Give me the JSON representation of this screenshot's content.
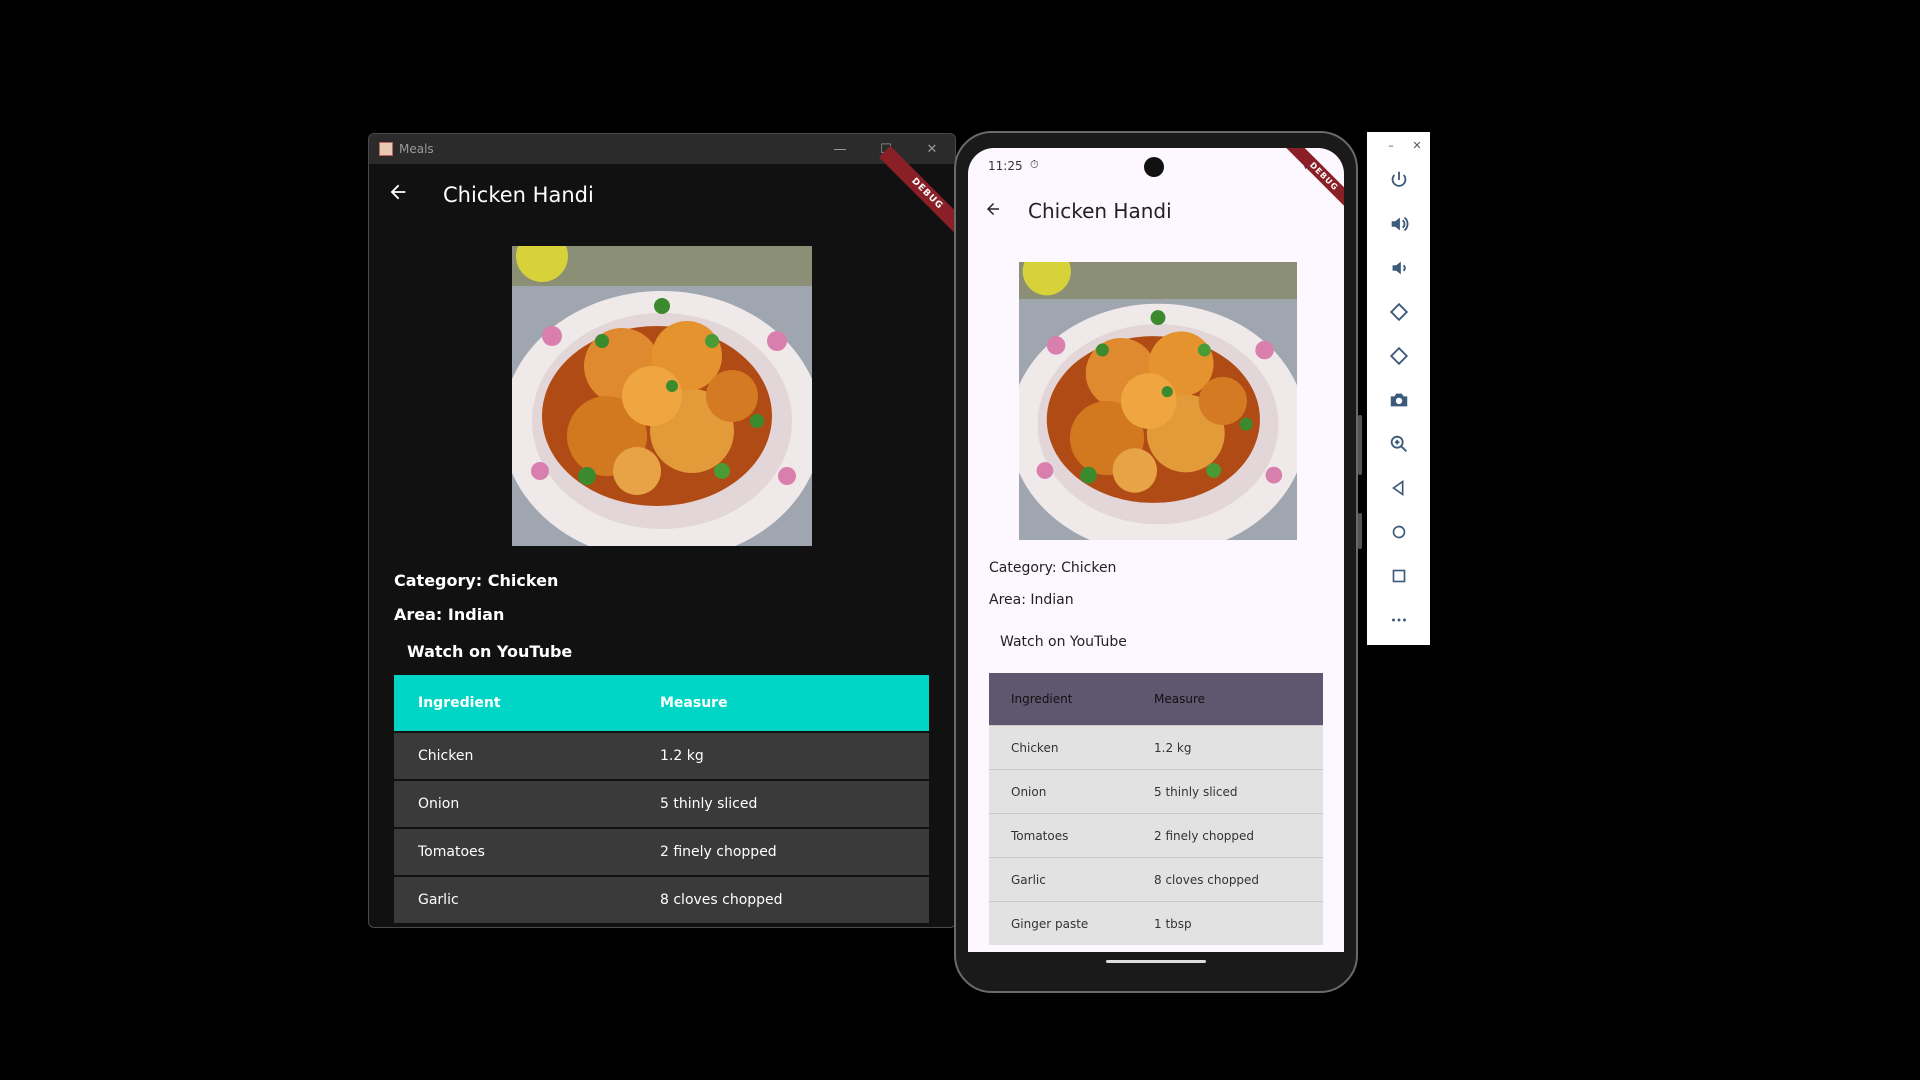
{
  "desktop": {
    "window_title": "Meals",
    "controls": {
      "minimize": "—",
      "maximize": "☐",
      "close": "✕"
    },
    "debug_label": "DEBUG",
    "back_icon": "arrow-left-icon",
    "heading": "Chicken Handi",
    "category": "Category: Chicken",
    "area": "Area: Indian",
    "youtube": "Watch on YouTube",
    "table": {
      "headers": [
        "Ingredient",
        "Measure"
      ],
      "rows": [
        [
          "Chicken",
          "1.2 kg"
        ],
        [
          "Onion",
          "5 thinly sliced"
        ],
        [
          "Tomatoes",
          "2 finely chopped"
        ],
        [
          "Garlic",
          "8 cloves chopped"
        ]
      ]
    }
  },
  "phone": {
    "time": "11:25",
    "debug_label": "DEBUG",
    "heading": "Chicken Handi",
    "category": "Category: Chicken",
    "area": "Area: Indian",
    "youtube": "Watch on YouTube",
    "table": {
      "headers": [
        "Ingredient",
        "Measure"
      ],
      "rows": [
        [
          "Chicken",
          "1.2 kg"
        ],
        [
          "Onion",
          "5 thinly sliced"
        ],
        [
          "Tomatoes",
          "2 finely chopped"
        ],
        [
          "Garlic",
          "8 cloves chopped"
        ],
        [
          "Ginger paste",
          "1 tbsp"
        ]
      ]
    }
  },
  "toolbar": {
    "minimize": "–",
    "close": "✕",
    "items": [
      "power-icon",
      "volume-up-icon",
      "volume-down-icon",
      "rotate-left-icon",
      "rotate-right-icon",
      "camera-icon",
      "zoom-icon",
      "back-icon",
      "home-icon",
      "overview-icon",
      "more-icon"
    ]
  },
  "colors": {
    "desktop_header": "#00d5c6",
    "phone_header": "#5f5770",
    "toolbar_icon": "#3c5a7a"
  }
}
